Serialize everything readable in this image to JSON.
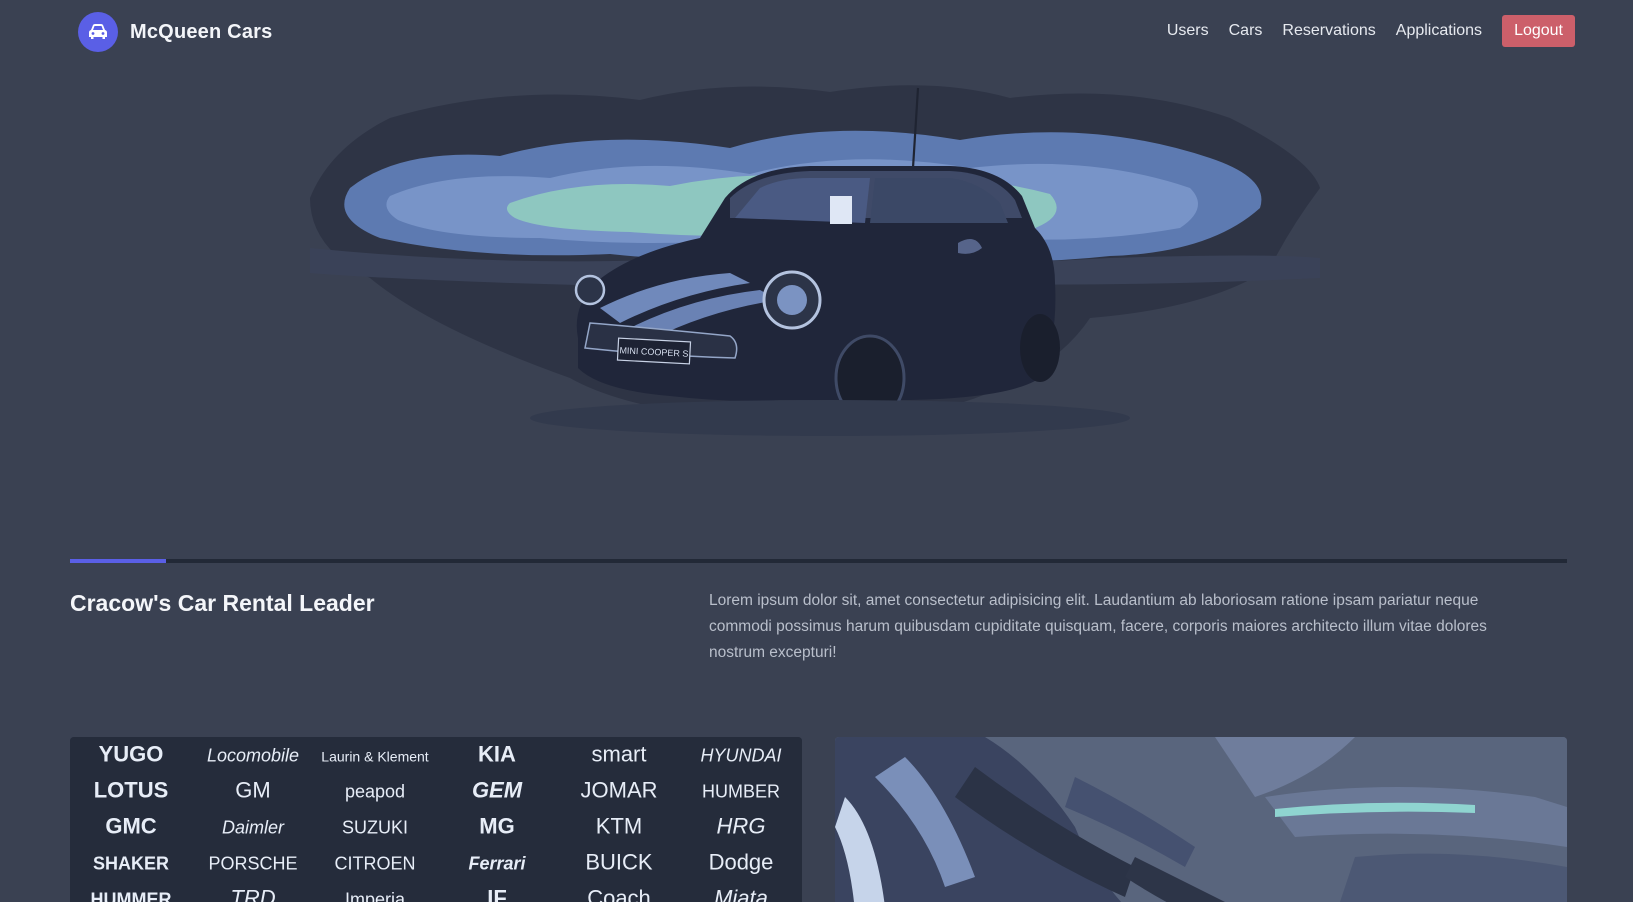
{
  "navbar": {
    "brand": "McQueen Cars",
    "brand_icon": "car-icon",
    "links": [
      "Users",
      "Cars",
      "Reservations",
      "Applications"
    ],
    "logout_label": "Logout"
  },
  "hero": {
    "plate_text": "MINI COOPER S"
  },
  "intro": {
    "headline": "Cracow's Car Rental Leader",
    "body": "Lorem ipsum dolor sit, amet consectetur adipisicing elit. Laudantium ab laboriosam ratione ipsam pariatur neque commodi possimus harum quibusdam cupiditate quisquam, facere, corporis maiores architecto illum vitae dolores nostrum excepturi!"
  },
  "cards": {
    "left_logos": [
      "YUGO",
      "Locomobile",
      "Laurin & Klement",
      "KIA",
      "smart",
      "HYUNDAI",
      "LOTUS",
      "GM",
      "peapod",
      "GEM",
      "JOMAR",
      "HUMBER",
      "GMC",
      "Daimler",
      "SUZUKI",
      "MG",
      "KTM",
      "HRG",
      "SHAKER",
      "PORSCHE",
      "CITROEN",
      "Ferrari",
      "BUICK",
      "Dodge",
      "HUMMER",
      "TRD",
      "Imperia",
      "IF",
      "Coach",
      "Miata"
    ]
  },
  "colors": {
    "background": "#3a4152",
    "accent": "#5a5fe6",
    "logout": "#cc5f6a"
  }
}
